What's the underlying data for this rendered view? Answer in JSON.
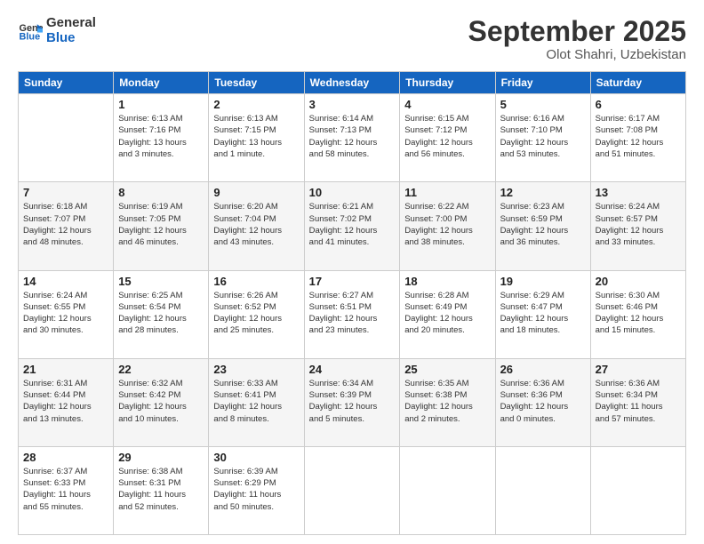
{
  "logo": {
    "line1": "General",
    "line2": "Blue"
  },
  "title": "September 2025",
  "subtitle": "Olot Shahri, Uzbekistan",
  "header_days": [
    "Sunday",
    "Monday",
    "Tuesday",
    "Wednesday",
    "Thursday",
    "Friday",
    "Saturday"
  ],
  "weeks": [
    [
      {
        "day": "",
        "info": ""
      },
      {
        "day": "1",
        "info": "Sunrise: 6:13 AM\nSunset: 7:16 PM\nDaylight: 13 hours\nand 3 minutes."
      },
      {
        "day": "2",
        "info": "Sunrise: 6:13 AM\nSunset: 7:15 PM\nDaylight: 13 hours\nand 1 minute."
      },
      {
        "day": "3",
        "info": "Sunrise: 6:14 AM\nSunset: 7:13 PM\nDaylight: 12 hours\nand 58 minutes."
      },
      {
        "day": "4",
        "info": "Sunrise: 6:15 AM\nSunset: 7:12 PM\nDaylight: 12 hours\nand 56 minutes."
      },
      {
        "day": "5",
        "info": "Sunrise: 6:16 AM\nSunset: 7:10 PM\nDaylight: 12 hours\nand 53 minutes."
      },
      {
        "day": "6",
        "info": "Sunrise: 6:17 AM\nSunset: 7:08 PM\nDaylight: 12 hours\nand 51 minutes."
      }
    ],
    [
      {
        "day": "7",
        "info": "Sunrise: 6:18 AM\nSunset: 7:07 PM\nDaylight: 12 hours\nand 48 minutes."
      },
      {
        "day": "8",
        "info": "Sunrise: 6:19 AM\nSunset: 7:05 PM\nDaylight: 12 hours\nand 46 minutes."
      },
      {
        "day": "9",
        "info": "Sunrise: 6:20 AM\nSunset: 7:04 PM\nDaylight: 12 hours\nand 43 minutes."
      },
      {
        "day": "10",
        "info": "Sunrise: 6:21 AM\nSunset: 7:02 PM\nDaylight: 12 hours\nand 41 minutes."
      },
      {
        "day": "11",
        "info": "Sunrise: 6:22 AM\nSunset: 7:00 PM\nDaylight: 12 hours\nand 38 minutes."
      },
      {
        "day": "12",
        "info": "Sunrise: 6:23 AM\nSunset: 6:59 PM\nDaylight: 12 hours\nand 36 minutes."
      },
      {
        "day": "13",
        "info": "Sunrise: 6:24 AM\nSunset: 6:57 PM\nDaylight: 12 hours\nand 33 minutes."
      }
    ],
    [
      {
        "day": "14",
        "info": "Sunrise: 6:24 AM\nSunset: 6:55 PM\nDaylight: 12 hours\nand 30 minutes."
      },
      {
        "day": "15",
        "info": "Sunrise: 6:25 AM\nSunset: 6:54 PM\nDaylight: 12 hours\nand 28 minutes."
      },
      {
        "day": "16",
        "info": "Sunrise: 6:26 AM\nSunset: 6:52 PM\nDaylight: 12 hours\nand 25 minutes."
      },
      {
        "day": "17",
        "info": "Sunrise: 6:27 AM\nSunset: 6:51 PM\nDaylight: 12 hours\nand 23 minutes."
      },
      {
        "day": "18",
        "info": "Sunrise: 6:28 AM\nSunset: 6:49 PM\nDaylight: 12 hours\nand 20 minutes."
      },
      {
        "day": "19",
        "info": "Sunrise: 6:29 AM\nSunset: 6:47 PM\nDaylight: 12 hours\nand 18 minutes."
      },
      {
        "day": "20",
        "info": "Sunrise: 6:30 AM\nSunset: 6:46 PM\nDaylight: 12 hours\nand 15 minutes."
      }
    ],
    [
      {
        "day": "21",
        "info": "Sunrise: 6:31 AM\nSunset: 6:44 PM\nDaylight: 12 hours\nand 13 minutes."
      },
      {
        "day": "22",
        "info": "Sunrise: 6:32 AM\nSunset: 6:42 PM\nDaylight: 12 hours\nand 10 minutes."
      },
      {
        "day": "23",
        "info": "Sunrise: 6:33 AM\nSunset: 6:41 PM\nDaylight: 12 hours\nand 8 minutes."
      },
      {
        "day": "24",
        "info": "Sunrise: 6:34 AM\nSunset: 6:39 PM\nDaylight: 12 hours\nand 5 minutes."
      },
      {
        "day": "25",
        "info": "Sunrise: 6:35 AM\nSunset: 6:38 PM\nDaylight: 12 hours\nand 2 minutes."
      },
      {
        "day": "26",
        "info": "Sunrise: 6:36 AM\nSunset: 6:36 PM\nDaylight: 12 hours\nand 0 minutes."
      },
      {
        "day": "27",
        "info": "Sunrise: 6:36 AM\nSunset: 6:34 PM\nDaylight: 11 hours\nand 57 minutes."
      }
    ],
    [
      {
        "day": "28",
        "info": "Sunrise: 6:37 AM\nSunset: 6:33 PM\nDaylight: 11 hours\nand 55 minutes."
      },
      {
        "day": "29",
        "info": "Sunrise: 6:38 AM\nSunset: 6:31 PM\nDaylight: 11 hours\nand 52 minutes."
      },
      {
        "day": "30",
        "info": "Sunrise: 6:39 AM\nSunset: 6:29 PM\nDaylight: 11 hours\nand 50 minutes."
      },
      {
        "day": "",
        "info": ""
      },
      {
        "day": "",
        "info": ""
      },
      {
        "day": "",
        "info": ""
      },
      {
        "day": "",
        "info": ""
      }
    ]
  ]
}
